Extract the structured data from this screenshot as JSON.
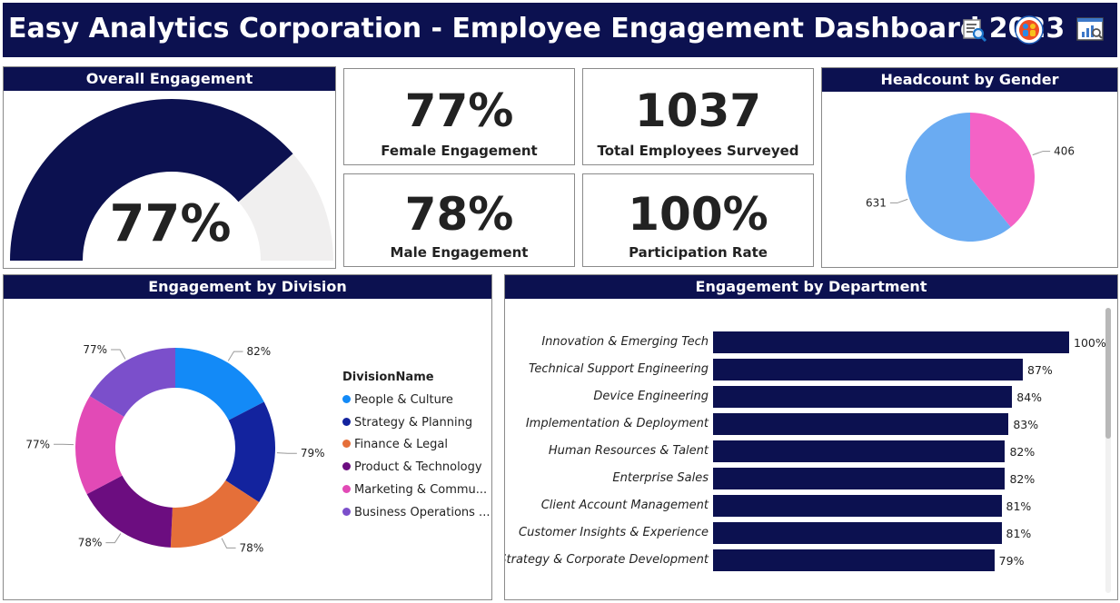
{
  "header": {
    "title": "Easy Analytics Corporation - Employee Engagement Dashboard 2023",
    "icons": [
      "report-search-icon",
      "people-insights-icon",
      "analytics-screen-icon"
    ]
  },
  "overall": {
    "title": "Overall Engagement",
    "value_text": "77%",
    "value": 0.77,
    "fill_color": "#0c1150",
    "track_color": "#f0efef"
  },
  "kpis": {
    "female": {
      "value": "77%",
      "label": "Female Engagement"
    },
    "total": {
      "value": "1037",
      "label": "Total Employees Surveyed"
    },
    "male": {
      "value": "78%",
      "label": "Male Engagement"
    },
    "participation": {
      "value": "100%",
      "label": "Participation Rate"
    }
  },
  "gender": {
    "title": "Headcount by Gender"
  },
  "division": {
    "title": "Engagement by Division",
    "legend_title": "DivisionName",
    "legend": [
      "People & Culture",
      "Strategy & Planning",
      "Finance & Legal",
      "Product & Technology",
      "Marketing & Commu...",
      "Business Operations ..."
    ]
  },
  "department": {
    "title": "Engagement by Department"
  },
  "chart_data": [
    {
      "type": "pie",
      "title": "Headcount by Gender",
      "categories": [
        "",
        ""
      ],
      "values": [
        406,
        631
      ],
      "colors": [
        "#f462c6",
        "#6aabf2"
      ]
    },
    {
      "type": "pie",
      "title": "Engagement by Division",
      "categories": [
        "People & Culture",
        "Strategy & Planning",
        "Finance & Legal",
        "Product & Technology",
        "Marketing & Commu...",
        "Business Operations ..."
      ],
      "values": [
        82,
        79,
        78,
        78,
        77,
        77
      ],
      "labels": [
        "82%",
        "79%",
        "78%",
        "78%",
        "77%",
        "77%"
      ],
      "colors": [
        "#138af7",
        "#13239e",
        "#e56f39",
        "#6c0d80",
        "#e24ab6",
        "#7b4fcb"
      ]
    },
    {
      "type": "bar",
      "title": "Engagement by Department",
      "categories": [
        "Innovation & Emerging Tech",
        "Technical Support Engineering",
        "Device Engineering",
        "Implementation & Deployment",
        "Human Resources & Talent",
        "Enterprise Sales",
        "Client Account Management",
        "Customer Insights & Experience",
        "Strategy & Corporate Development"
      ],
      "values": [
        100,
        87,
        84,
        83,
        82,
        82,
        81,
        81,
        79
      ],
      "labels": [
        "100%",
        "87%",
        "84%",
        "83%",
        "82%",
        "82%",
        "81%",
        "81%",
        "79%"
      ],
      "xlim": [
        0,
        100
      ],
      "color": "#0c1150"
    }
  ]
}
